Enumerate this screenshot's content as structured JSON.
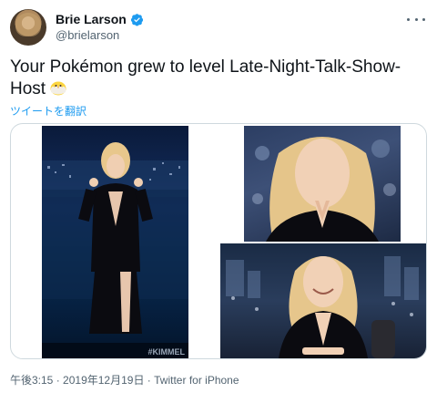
{
  "user": {
    "display_name": "Brie Larson",
    "handle": "@brielarson"
  },
  "tweet": {
    "text": "Your Pokémon grew to level Late-Night-Talk-Show-Host",
    "emoji": "chick-emoji",
    "translate_label": "ツイートを翻訳"
  },
  "media": {
    "photo_count": 3,
    "watermark": "#KIMMEL"
  },
  "footer": {
    "time": "午後3:15",
    "separator": "·",
    "date": "2019年12月19日",
    "client": "Twitter for iPhone"
  },
  "colors": {
    "accent": "#1d9bf0",
    "text": "#0f1419",
    "secondary": "#536471",
    "border": "#cfd9de"
  }
}
